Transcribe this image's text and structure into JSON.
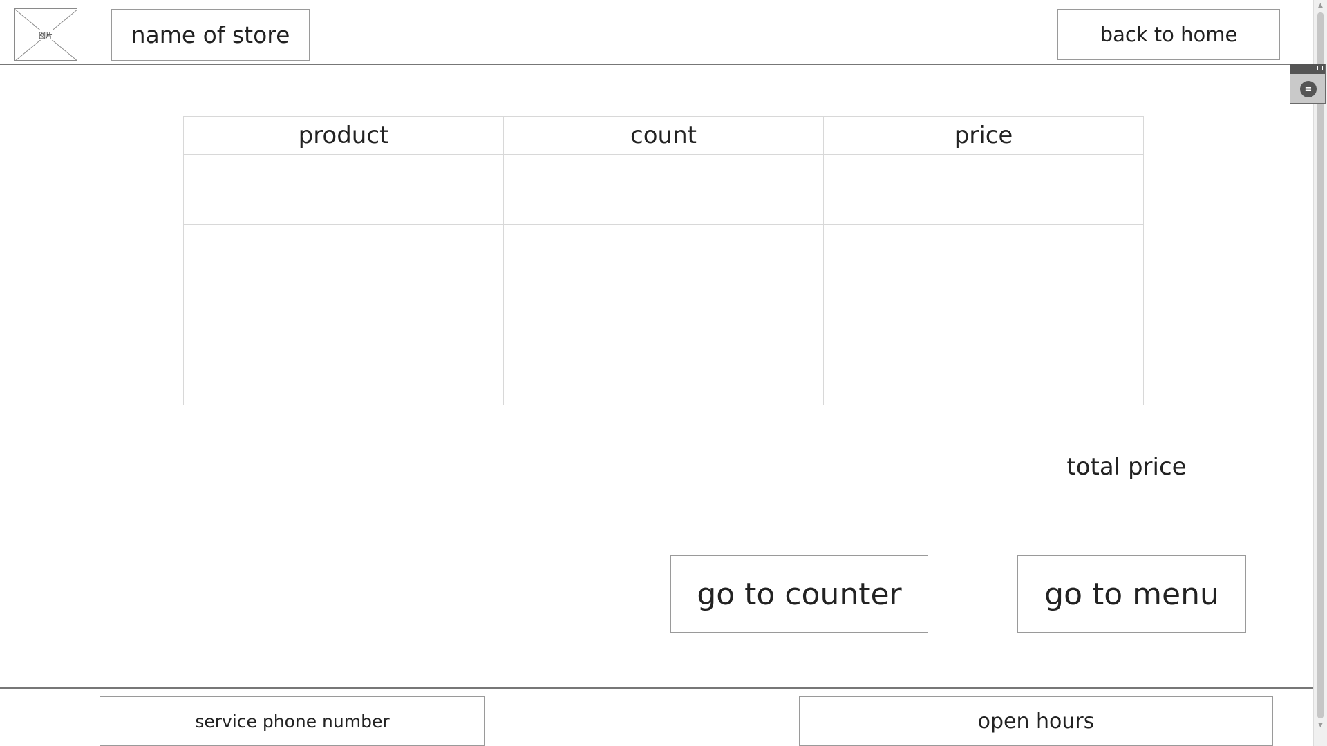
{
  "header": {
    "logo_placeholder": "图片",
    "store_name": "name of store",
    "back_home_label": "back to home"
  },
  "order_table": {
    "columns": [
      "product",
      "count",
      "price"
    ],
    "rows": [
      [
        "",
        "",
        ""
      ],
      [
        "",
        "",
        ""
      ]
    ]
  },
  "summary": {
    "total_label": "total price"
  },
  "actions": {
    "counter_label": "go to counter",
    "menu_label": "go to menu"
  },
  "footer": {
    "phone_label": "service phone number",
    "hours_label": "open hours"
  },
  "icons": {
    "scroll_up": "chevron-up-icon",
    "scroll_down": "chevron-down-icon",
    "widget": "menu-icon"
  },
  "colors": {
    "border": "#9a9a9a",
    "rule": "#777777",
    "widget_bar": "#555555"
  }
}
